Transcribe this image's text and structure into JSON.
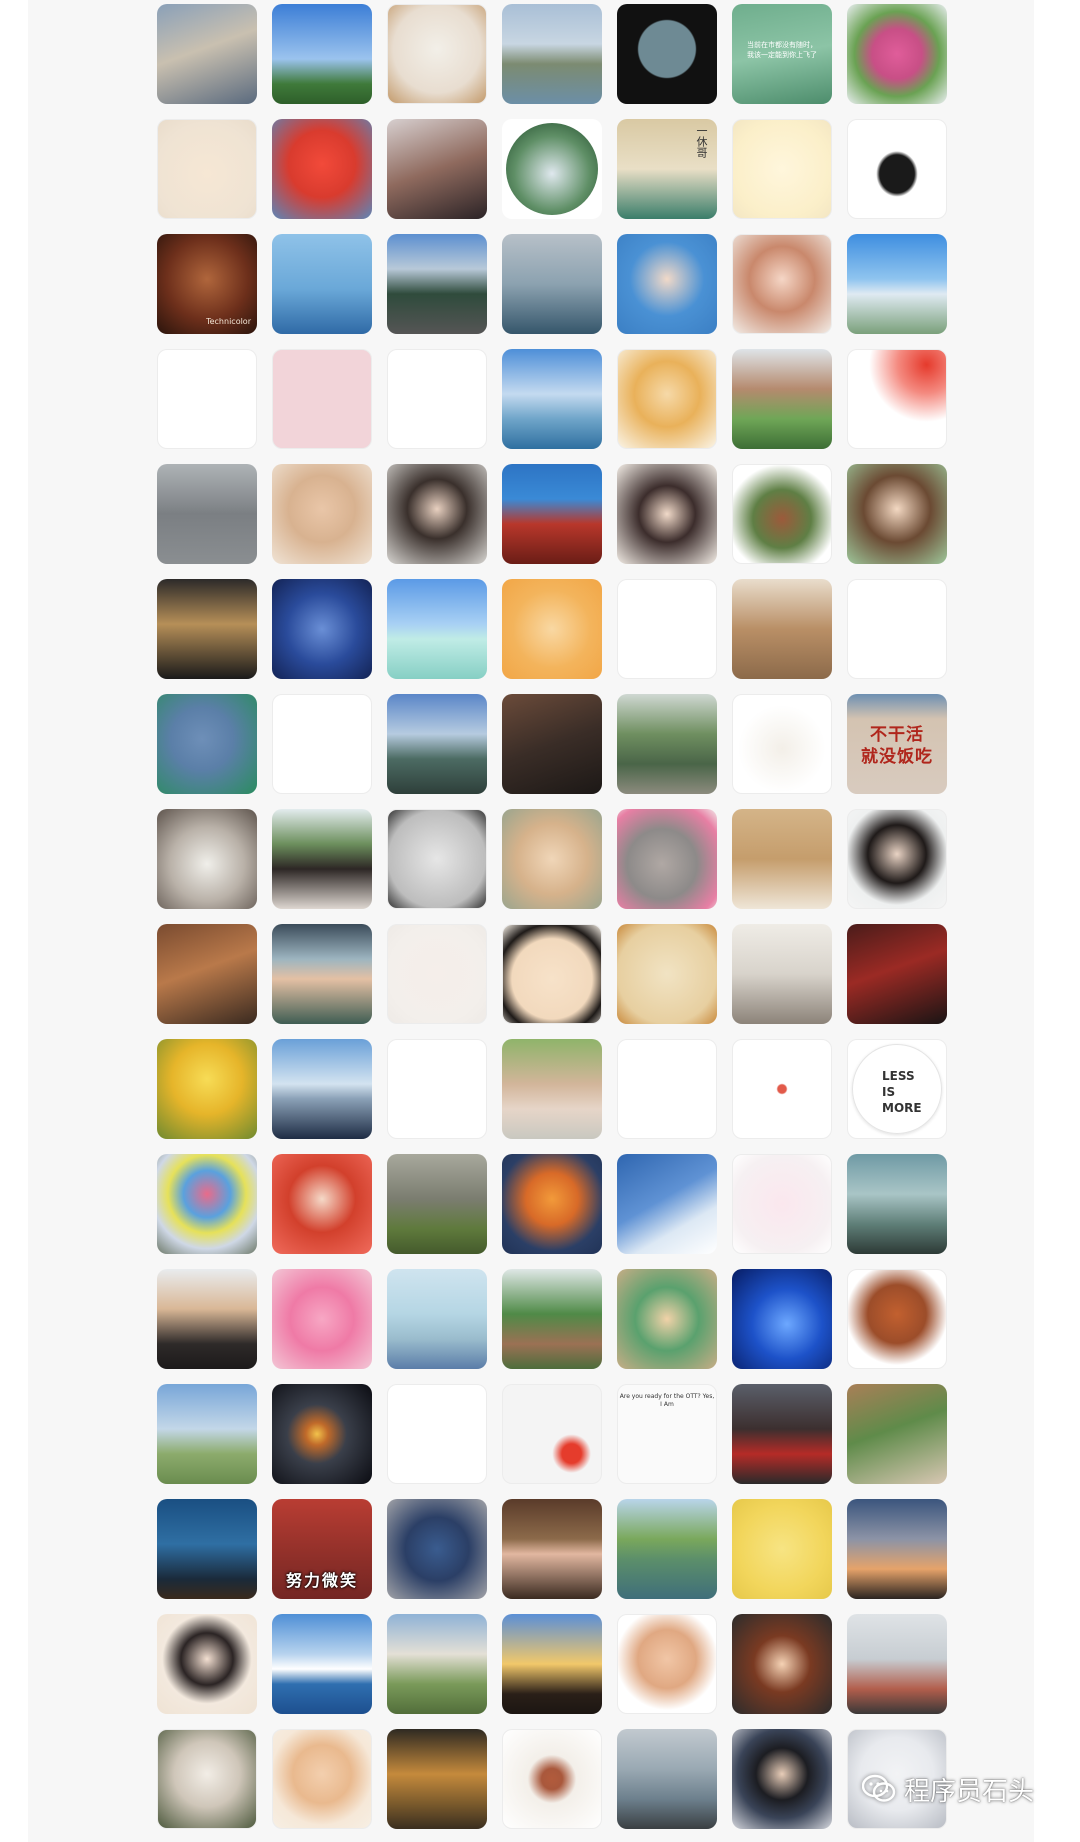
{
  "watermark": {
    "icon": "wechat-icon",
    "text": "程序员石头"
  },
  "avatar_texts": {
    "r1c6": "当前在市都没有随时，\n我该一定能到你上飞了",
    "r2c5": "一休哥",
    "r7c7": "不干活\n就没饭吃",
    "r10c7": "LESS\nIS\nMORE",
    "r13c5": "Are you ready for the OTT?  Yes, I Am",
    "r14c2": "努力微笑",
    "r3c1": "Technicolor"
  },
  "avatars": [
    {
      "name": "avatar-man-glasses-campus",
      "bg": "linear-gradient(160deg,#8aa0b8 0%,#c9c0b0 45%,#5a6a7e 100%)",
      "kind": "photo"
    },
    {
      "name": "avatar-blue-sky-trees",
      "bg": "linear-gradient(180deg,#3c7ed6 0%,#9bc3ee 55%,#3f7a3a 80%,#2e5f2a 100%)",
      "kind": "photo"
    },
    {
      "name": "avatar-cartoon-cat-basket",
      "bg": "radial-gradient(circle at 50% 45%,#f2efe8 0%,#e8ddd0 60%,#c39a6b 100%)",
      "kind": "light"
    },
    {
      "name": "avatar-lake-landscape",
      "bg": "linear-gradient(180deg,#a9bfd6 0%,#c8d6e2 40%,#7c8b71 60%,#6c8fa7 100%)",
      "kind": "photo"
    },
    {
      "name": "avatar-batman-silhouette",
      "bg": "radial-gradient(circle at 50% 45%,#6e8a94 0%,#6e8a94 38%,#111 40%,#111 100%)",
      "kind": "photo"
    },
    {
      "name": "avatar-green-plant-caption",
      "bg": "linear-gradient(170deg,#6fae8d 0%,#8cc4a6 50%,#4d8d6c 100%)",
      "kind": "photo"
    },
    {
      "name": "avatar-pink-peony",
      "bg": "radial-gradient(circle at 50% 50%,#e05d9a 0%,#c84f86 35%,#6aa253 60%,#e9eef0 100%)",
      "kind": "photo"
    },
    {
      "name": "avatar-cartoon-girl-drinking",
      "bg": "radial-gradient(circle at 50% 55%,#f6e7d4 0%,#efe3d3 70%,#e9dccb 100%)",
      "kind": "light"
    },
    {
      "name": "avatar-red-tiger-mascot",
      "bg": "radial-gradient(circle at 50% 45%,#f24a3a 0%,#d93b2e 45%,#5c86b8 100%)",
      "kind": "photo"
    },
    {
      "name": "avatar-girl-popsicle",
      "bg": "linear-gradient(160deg,#d7cfcf 0%,#8f6a5e 50%,#2b2326 100%)",
      "kind": "photo"
    },
    {
      "name": "avatar-round-forest-girl",
      "bg": "#ffffff",
      "inner": "radial-gradient(circle at 50% 55%,#dfe8ee 0%,#5f8f66 55%,#1f4a2a 100%)",
      "kind": "round"
    },
    {
      "name": "avatar-monk-ikkyu",
      "bg": "linear-gradient(180deg,#d9c9a3 0%,#e9dfc6 50%,#3a7d6a 100%)",
      "kind": "photo"
    },
    {
      "name": "avatar-cartoon-cat-hat",
      "bg": "radial-gradient(circle at 50% 50%,#fff6dc 0%,#fbefc9 70%,#f3e6c3 100%)",
      "kind": "light"
    },
    {
      "name": "avatar-black-sports-car",
      "bg": "radial-gradient(ellipse at 50% 55%,#1a1a1a 0%,#1a1a1a 25%,#ffffff 30%,#ffffff 100%)",
      "kind": "light"
    },
    {
      "name": "avatar-cartoon-boy-coco",
      "bg": "radial-gradient(circle at 50% 45%,#b0663c 0%,#6d2f1b 55%,#2a140c 100%)",
      "kind": "photo"
    },
    {
      "name": "avatar-windsurfing",
      "bg": "linear-gradient(180deg,#8fc2e8 0%,#6aa8d8 55%,#2f6aa6 100%)",
      "kind": "photo"
    },
    {
      "name": "avatar-mountain-road",
      "bg": "linear-gradient(180deg,#5c8fd0 0%,#b8c9d8 35%,#2f4b3c 60%,#555 100%)",
      "kind": "photo"
    },
    {
      "name": "avatar-grey-sea-pier",
      "bg": "linear-gradient(180deg,#b7c0c8 0%,#8ca2b0 50%,#35566b 100%)",
      "kind": "photo"
    },
    {
      "name": "avatar-cartoon-man-glasses",
      "bg": "radial-gradient(circle at 50% 45%,#f1d9c8 0%,#4a91d4 50%,#3b7fc4 100%)",
      "kind": "photo"
    },
    {
      "name": "avatar-woman-portrait-drawing",
      "bg": "radial-gradient(circle at 50% 45%,#f5d6c6 0%,#c9886c 45%,#f2ece6 100%)",
      "kind": "light"
    },
    {
      "name": "avatar-sky-person-net",
      "bg": "linear-gradient(180deg,#3e8ee0 0%,#8fc4ef 45%,#dfeaf2 60%,#7aa07a 100%)",
      "kind": "photo"
    },
    {
      "name": "avatar-umbrella-sketch",
      "bg": "#ffffff",
      "kind": "light"
    },
    {
      "name": "avatar-pixel-punk",
      "bg": "radial-gradient(circle at 50% 50%,#f2d4d9 0%,#f2d4d9 100%)",
      "kind": "light"
    },
    {
      "name": "avatar-smile-face-sketch",
      "bg": "#ffffff",
      "kind": "light"
    },
    {
      "name": "avatar-sea-clouds-ship",
      "bg": "linear-gradient(180deg,#4e8fd8 0%,#c4daf0 45%,#6fa5c9 70%,#2f6fa0 100%)",
      "kind": "photo"
    },
    {
      "name": "avatar-girl-red-braids",
      "bg": "radial-gradient(circle at 50% 45%,#f6d9a8 0%,#e9b15a 45%,#faf4e6 100%)",
      "kind": "light"
    },
    {
      "name": "avatar-graduate-campus",
      "bg": "linear-gradient(180deg,#dfe4e8 0%,#b58a6e 40%,#6fa657 70%,#3d6e35 100%)",
      "kind": "photo"
    },
    {
      "name": "avatar-flag-duck",
      "bg": "radial-gradient(circle at 80% 15%,#e53a2c 0%,#f48a80 25%,#ffffff 50%,#ffffff 100%)",
      "kind": "light"
    },
    {
      "name": "avatar-girl-feeding-birds",
      "bg": "linear-gradient(180deg,#aeb3b6 0%,#7b7f83 50%,#8a8e91 100%)",
      "kind": "photo"
    },
    {
      "name": "avatar-woman-selfie-baby",
      "bg": "radial-gradient(circle at 50% 45%,#e9c6a8 0%,#d8b290 45%,#f0e4d6 100%)",
      "kind": "photo"
    },
    {
      "name": "avatar-girl-short-hair",
      "bg": "radial-gradient(circle at 50% 45%,#e8d0c0 0%,#3a302c 40%,#d8d6d2 100%)",
      "kind": "photo"
    },
    {
      "name": "avatar-spirited-away-train",
      "bg": "linear-gradient(180deg,#2d74c4 0%,#3a8ad6 35%,#b8372b 60%,#6a1d16 100%)",
      "kind": "photo"
    },
    {
      "name": "avatar-anime-man-dark-hair",
      "bg": "radial-gradient(circle at 50% 50%,#f1dac9 0%,#3c2d2c 40%,#f3ede6 100%)",
      "kind": "photo"
    },
    {
      "name": "avatar-cartoon-girl-green-scarf",
      "bg": "radial-gradient(circle at 50% 55%,#9c5a3b 0%,#5f7f45 40%,#ffffff 75%,#ffffff 100%)",
      "kind": "light"
    },
    {
      "name": "avatar-woman-glasses-drawing",
      "bg": "radial-gradient(circle at 50% 45%,#f3d8c2 0%,#6b4a33 45%,#9ec79b 100%)",
      "kind": "photo"
    },
    {
      "name": "avatar-man-glasses-night",
      "bg": "linear-gradient(180deg,#2c2a29 0%,#b68f58 45%,#1a1a1a 100%)",
      "kind": "photo"
    },
    {
      "name": "avatar-starry-night-couple",
      "bg": "radial-gradient(circle at 50% 50%,#6a8fd6 0%,#2a4b9b 50%,#132355 100%)",
      "kind": "photo"
    },
    {
      "name": "avatar-salt-lake-reflection",
      "bg": "linear-gradient(180deg,#5b9ae6 0%,#a8d0f4 45%,#c0ece6 60%,#86cfc4 100%)",
      "kind": "photo"
    },
    {
      "name": "avatar-cartoon-girl-orange",
      "bg": "radial-gradient(circle at 50% 50%,#f9d8a3 0%,#f3b45c 55%,#f2a646 100%)",
      "kind": "photo"
    },
    {
      "name": "avatar-cartoon-umbrella-rabbit",
      "bg": "#ffffff",
      "kind": "light"
    },
    {
      "name": "avatar-basketball-court",
      "bg": "linear-gradient(180deg,#e9ddcc 0%,#b98f66 50%,#8c6a4a 100%)",
      "kind": "photo"
    },
    {
      "name": "avatar-glass-water-cartoon",
      "bg": "#ffffff",
      "kind": "light"
    },
    {
      "name": "avatar-tom-cat-cartoon",
      "bg": "radial-gradient(circle at 45% 45%,#6e8fb8 0%,#5b7fa8 40%,#2b8c60 100%)",
      "kind": "photo"
    },
    {
      "name": "avatar-broken-hand-sketch",
      "bg": "#ffffff",
      "kind": "light"
    },
    {
      "name": "avatar-mountain-lake-man",
      "bg": "linear-gradient(180deg,#5a86c8 0%,#b6cbe0 40%,#4c6b63 65%,#2e3f3a 100%)",
      "kind": "photo"
    },
    {
      "name": "avatar-man-phone-dark",
      "bg": "linear-gradient(160deg,#6b4b3a 0%,#3a2d27 50%,#1c1816 100%)",
      "kind": "photo"
    },
    {
      "name": "avatar-woman-riverside",
      "bg": "linear-gradient(180deg,#cfd8d2 0%,#6f8f60 40%,#4a6548 70%,#8c8b7e 100%)",
      "kind": "photo"
    },
    {
      "name": "avatar-white-dog-cartoon",
      "bg": "radial-gradient(circle at 50% 55%,#f3efe8 0%,#ffffff 60%,#ffffff 100%)",
      "kind": "light"
    },
    {
      "name": "avatar-slogan-wall",
      "bg": "linear-gradient(180deg,#6e90b2 0%,#d4c3b1 25%,#d8cbbf 100%)",
      "kind": "photo"
    },
    {
      "name": "avatar-screaming-cat",
      "bg": "radial-gradient(circle at 50% 55%,#f0efea 0%,#b9b1a8 50%,#5e544d 100%)",
      "kind": "photo"
    },
    {
      "name": "avatar-woman-park",
      "bg": "linear-gradient(180deg,#e3ecee 0%,#6c8f5d 35%,#2d2725 60%,#ded7d1 100%)",
      "kind": "photo"
    },
    {
      "name": "avatar-cat-window-sketch",
      "bg": "radial-gradient(circle at 50% 50%,#e6e6e6 0%,#bdbdbd 70%,#333 100%)",
      "kind": "light"
    },
    {
      "name": "avatar-baby-with-hat",
      "bg": "radial-gradient(circle at 50% 50%,#f0d6b8 0%,#d6b28b 50%,#9aa58e 100%)",
      "kind": "photo"
    },
    {
      "name": "avatar-cat-with-roses",
      "bg": "radial-gradient(circle at 45% 55%,#b0a8a4 0%,#8d8a89 45%,#e77fa4 80%,#f2eaea 100%)",
      "kind": "photo"
    },
    {
      "name": "avatar-child-bookshelf",
      "bg": "linear-gradient(180deg,#d4b488 0%,#c59d6c 50%,#efe6d8 100%)",
      "kind": "photo"
    },
    {
      "name": "avatar-woman-white-shirt",
      "bg": "radial-gradient(circle at 50% 45%,#e9d3c4 0%,#1f1a19 40%,#eef0f0 70%,#f5f5f5 100%)",
      "kind": "light"
    },
    {
      "name": "avatar-bookstore-boy",
      "bg": "linear-gradient(160deg,#7a4b30 0%,#b9794a 45%,#3a2a20 100%)",
      "kind": "photo"
    },
    {
      "name": "avatar-window-sunset-mountain",
      "bg": "linear-gradient(180deg,#3b4c5a 0%,#9db5c0 35%,#e4c0a4 55%,#3f5d53 100%)",
      "kind": "photo"
    },
    {
      "name": "avatar-girl-drinking-bottle",
      "bg": "radial-gradient(circle at 50% 50%,#f5eeea 0%,#f3efeb 70%,#eeeae6 100%)",
      "kind": "light"
    },
    {
      "name": "avatar-comic-boy-face",
      "bg": "radial-gradient(circle at 50% 55%,#f7e2c9 0%,#f2d9bd 55%,#1e1a18 75%,#f7f0e6 100%)",
      "kind": "light"
    },
    {
      "name": "avatar-astronaut-fish-art",
      "bg": "radial-gradient(circle at 50% 50%,#f1e3c3 0%,#e7cfa0 70%,#c98a3c 100%)",
      "kind": "photo"
    },
    {
      "name": "avatar-dog-carpet",
      "bg": "linear-gradient(180deg,#efece6 0%,#d8d3cb 50%,#8c8379 100%)",
      "kind": "photo"
    },
    {
      "name": "avatar-masked-knight-red",
      "bg": "linear-gradient(160deg,#4a1c1a 0%,#9b2a24 45%,#1a1414 100%)",
      "kind": "photo"
    },
    {
      "name": "avatar-golden-ginkgo",
      "bg": "radial-gradient(circle at 50% 40%,#f7dc56 0%,#e6b52a 45%,#6f8a2f 100%)",
      "kind": "photo"
    },
    {
      "name": "avatar-sky-dog-car",
      "bg": "linear-gradient(180deg,#6aa0d8 0%,#d3e3f0 45%,#8aa0b6 60%,#1e2c44 100%)",
      "kind": "photo"
    },
    {
      "name": "avatar-wide-eyes-face",
      "bg": "#ffffff",
      "kind": "light"
    },
    {
      "name": "avatar-father-child-garden",
      "bg": "linear-gradient(180deg,#8fb46a 0%,#d2b59a 45%,#e6d5c8 70%,#c9c8c0 100%)",
      "kind": "photo"
    },
    {
      "name": "avatar-messy-hair-sketch",
      "bg": "#ffffff",
      "kind": "light"
    },
    {
      "name": "avatar-small-red-star",
      "bg": "radial-gradient(circle at 50% 50%,#e25a4a 0%,#e25a4a 6%,#ffffff 8%,#ffffff 100%)",
      "kind": "light"
    },
    {
      "name": "avatar-less-is-more",
      "bg": "#ffffff",
      "inner": "#ffffff",
      "kind": "round-border"
    },
    {
      "name": "avatar-colorful-balloons",
      "bg": "radial-gradient(circle at 50% 40%,#e96b8a 0%,#5aa1de 30%,#e6e15a 50%,#cfd8e6 70%,#6e7a6a 100%)",
      "kind": "photo"
    },
    {
      "name": "avatar-anime-girl-cat-ears",
      "bg": "radial-gradient(circle at 50% 45%,#f5d9c8 0%,#d2402c 45%,#f06b5c 100%)",
      "kind": "photo"
    },
    {
      "name": "avatar-hiker-field",
      "bg": "linear-gradient(180deg,#a8a89c 0%,#7b7d70 45%,#5f7a3c 75%,#445a2c 100%)",
      "kind": "photo"
    },
    {
      "name": "avatar-tiger-cartoon-navy",
      "bg": "radial-gradient(circle at 50% 45%,#f29a3a 0%,#d86a28 35%,#2b3f66 70%,#213357 100%)",
      "kind": "photo"
    },
    {
      "name": "avatar-blue-sky-cloud",
      "bg": "linear-gradient(150deg,#2f66b0 0%,#5f92d4 45%,#dce8f4 70%,#ffffff 100%)",
      "kind": "photo"
    },
    {
      "name": "avatar-wedding-couple-cartoon",
      "bg": "radial-gradient(circle at 50% 50%,#fbe7ee 0%,#f6f0f2 70%,#ffffff 100%)",
      "kind": "light"
    },
    {
      "name": "avatar-magritte-apple",
      "bg": "linear-gradient(180deg,#6f9aa5 0%,#a9c5c6 40%,#5f7f78 70%,#2d3a36 100%)",
      "kind": "photo"
    },
    {
      "name": "avatar-man-white-hat",
      "bg": "linear-gradient(180deg,#e9ecee 0%,#d9b796 40%,#2e2a29 75%,#1c1a1a 100%)",
      "kind": "photo"
    },
    {
      "name": "avatar-pink-toy-rabbit",
      "bg": "radial-gradient(circle at 50% 50%,#f7a7c4 0%,#ef7aa6 45%,#f3c7d6 100%)",
      "kind": "photo"
    },
    {
      "name": "avatar-tree-on-book",
      "bg": "linear-gradient(180deg,#cfe4ef 0%,#b5d6e4 45%,#9abccd 70%,#5b7da8 100%)",
      "kind": "photo"
    },
    {
      "name": "avatar-palm-tree-resort",
      "bg": "linear-gradient(180deg,#dfe7e6 0%,#4f8a47 45%,#9b7154 75%,#4d6d3c 100%)",
      "kind": "photo"
    },
    {
      "name": "avatar-cartoon-family",
      "bg": "radial-gradient(circle at 50% 50%,#f1d2a8 0%,#5aa16e 45%,#c7ad86 100%)",
      "kind": "photo"
    },
    {
      "name": "avatar-starry-blue-girl",
      "bg": "radial-gradient(circle at 55% 55%,#6da8ff 0%,#1d52c9 45%,#071c63 100%)",
      "kind": "photo"
    },
    {
      "name": "avatar-watermelon-cartoon",
      "bg": "radial-gradient(circle at 50% 45%,#c2602f 0%,#9c4d2a 40%,#ffffff 70%,#ffffff 100%)",
      "kind": "light"
    },
    {
      "name": "avatar-woman-grassland-hat",
      "bg": "linear-gradient(180deg,#78a6d8 0%,#c3d7e8 45%,#8cab6c 70%,#6a8c4f 100%)",
      "kind": "photo"
    },
    {
      "name": "avatar-planet-space",
      "bg": "radial-gradient(circle at 45% 50%,#f2c24b 0%,#c06a2a 15%,#3a3f4a 40%,#0b0c12 100%)",
      "kind": "photo"
    },
    {
      "name": "avatar-cap-boy-sketch",
      "bg": "#ffffff",
      "kind": "light"
    },
    {
      "name": "avatar-doodle-flag",
      "bg": "radial-gradient(circle at 70% 70%,#e53c2c 0%,#e53c2c 10%,#f4f4f4 20%,#f4f4f4 100%)",
      "kind": "light"
    },
    {
      "name": "avatar-meme-comic",
      "bg": "#fafafa",
      "kind": "light"
    },
    {
      "name": "avatar-football-fans",
      "bg": "linear-gradient(180deg,#5a5f6a 0%,#3c2f2f 45%,#b52b27 70%,#2a2a2a 100%)",
      "kind": "photo"
    },
    {
      "name": "avatar-woman-painting-room",
      "bg": "linear-gradient(160deg,#a97f57 0%,#5f8b4a 45%,#d8c7b3 100%)",
      "kind": "photo"
    },
    {
      "name": "avatar-seal-underwater",
      "bg": "linear-gradient(180deg,#1a4f82 0%,#2f6fa3 45%,#1a2a3a 80%,#3a2a1c 100%)",
      "kind": "photo"
    },
    {
      "name": "avatar-smile-woman-caption",
      "bg": "linear-gradient(180deg,#b93d33 0%,#8e2f29 60%,#742623 100%)",
      "kind": "photo"
    },
    {
      "name": "avatar-owl-glasses-cartoon",
      "bg": "radial-gradient(circle at 50% 50%,#3a5c8f 0%,#2b3f66 45%,#a2a3a8 100%)",
      "kind": "photo"
    },
    {
      "name": "avatar-man-doorway",
      "bg": "linear-gradient(180deg,#5a3b2a 0%,#8c6a4a 40%,#e2b7a0 55%,#3a2a20 100%)",
      "kind": "photo"
    },
    {
      "name": "avatar-green-lake-boats",
      "bg": "linear-gradient(180deg,#b9d5ea 0%,#7aa85c 40%,#5c8f6a 60%,#3f6e7a 100%)",
      "kind": "photo"
    },
    {
      "name": "avatar-bull-terrier-art",
      "bg": "radial-gradient(circle at 50% 50%,#f7e483 0%,#f2d65c 60%,#e6c84a 100%)",
      "kind": "photo"
    },
    {
      "name": "avatar-sunset-silhouette",
      "bg": "linear-gradient(180deg,#3b557d 0%,#8c93a6 40%,#e6a36a 70%,#2a2420 100%)",
      "kind": "photo"
    },
    {
      "name": "avatar-woman-white-top",
      "bg": "radial-gradient(circle at 50% 45%,#f3dfd1 0%,#2b2424 35%,#f3e9de 60%,#efe3d4 100%)",
      "kind": "photo"
    },
    {
      "name": "avatar-snow-mountain-sea",
      "bg": "linear-gradient(180deg,#4f8fd6 0%,#b7d3ee 40%,#ffffff 55%,#2f6fb0 70%,#1d4f8f 100%)",
      "kind": "photo"
    },
    {
      "name": "avatar-yurt-girl",
      "bg": "linear-gradient(180deg,#8fb2d6 0%,#e4e0d6 40%,#7a9a5a 70%,#526e3a 100%)",
      "kind": "photo"
    },
    {
      "name": "avatar-silhouette-sunset-jump",
      "bg": "linear-gradient(180deg,#5b8fd6 0%,#f2c86a 50%,#2a1f18 80%,#1c1612 100%)",
      "kind": "photo"
    },
    {
      "name": "avatar-bald-man-glasses-cartoon",
      "bg": "radial-gradient(circle at 50% 45%,#f1c6a6 0%,#e0a882 40%,#ffffff 70%,#ffffff 100%)",
      "kind": "light"
    },
    {
      "name": "avatar-cartoon-girl-red-coat",
      "bg": "radial-gradient(circle at 50% 50%,#f5d2b4 0%,#7a3a22 40%,#2c2c2c 100%)",
      "kind": "photo"
    },
    {
      "name": "avatar-father-son-sky",
      "bg": "linear-gradient(180deg,#dfe3e6 0%,#c7cdd2 45%,#b25e4c 75%,#3a3838 100%)",
      "kind": "photo"
    },
    {
      "name": "avatar-anime-white-hair",
      "bg": "radial-gradient(circle at 50% 45%,#f2ede6 0%,#cfc6b9 45%,#4e5a3e 100%)",
      "kind": "light"
    },
    {
      "name": "avatar-cartoon-man-glasses-beard",
      "bg": "radial-gradient(circle at 50% 45%,#f3cfae 0%,#e9b98e 40%,#f6e8d8 70%,#f7efe4 100%)",
      "kind": "light"
    },
    {
      "name": "avatar-tiger-cub",
      "bg": "linear-gradient(180deg,#2f2a22 0%,#c58a3c 45%,#7a5a2c 75%,#3a2e1f 100%)",
      "kind": "photo"
    },
    {
      "name": "avatar-framed-dancer",
      "bg": "radial-gradient(circle at 50% 50%,#b25b3c 0%,#a9583c 15%,#f3efe9 35%,#ffffff 100%)",
      "kind": "light"
    },
    {
      "name": "avatar-seaside-rocks",
      "bg": "linear-gradient(180deg,#c2c9cf 0%,#9aa9b3 40%,#6d808d 70%,#3a3f42 100%)",
      "kind": "photo"
    },
    {
      "name": "avatar-man-suit",
      "bg": "radial-gradient(circle at 50% 45%,#e8cdb8 0%,#1c1d22 35%,#3a4458 60%,#d6d8de 100%)",
      "kind": "photo"
    },
    {
      "name": "avatar-white-cartoon-cat",
      "bg": "radial-gradient(circle at 50% 45%,#f2f3f5 0%,#e8eaee 50%,#b8bcc4 100%)",
      "kind": "light"
    }
  ]
}
